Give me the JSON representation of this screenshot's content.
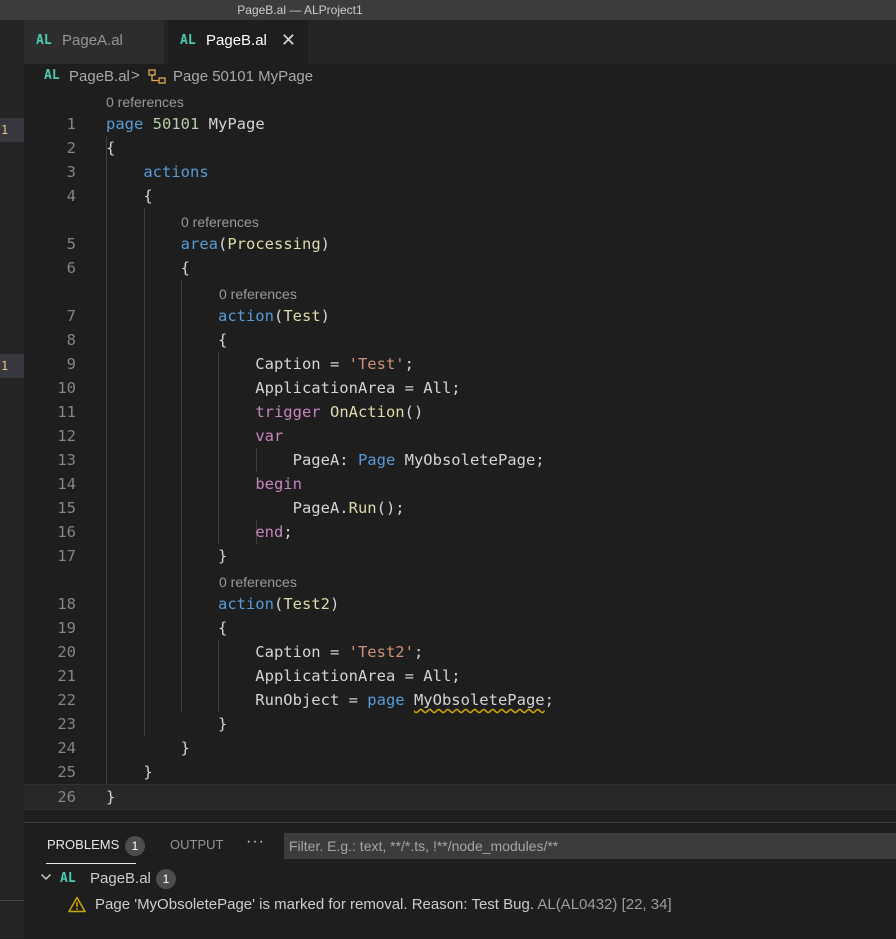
{
  "window": {
    "title": "PageB.al — ALProject1"
  },
  "tabs": [
    {
      "lang": "AL",
      "label": "PageA.al"
    },
    {
      "lang": "AL",
      "label": "PageB.al",
      "close": "✕"
    }
  ],
  "breadcrumb": {
    "lang": "AL",
    "file": "PageB.al",
    "separator": ">",
    "symbol": "Page 50101 MyPage"
  },
  "gutter_marks": [
    "1",
    "1"
  ],
  "codelens": {
    "text": "0 references"
  },
  "code_lines": [
    {
      "n": "1",
      "t": "page 50101 MyPage"
    },
    {
      "n": "2",
      "t": "{"
    },
    {
      "n": "3",
      "t": "    actions"
    },
    {
      "n": "4",
      "t": "    {"
    },
    {
      "n": "5",
      "t": "        area(Processing)"
    },
    {
      "n": "6",
      "t": "        {"
    },
    {
      "n": "7",
      "t": "            action(Test)"
    },
    {
      "n": "8",
      "t": "            {"
    },
    {
      "n": "9",
      "t": "                Caption = 'Test';"
    },
    {
      "n": "10",
      "t": "                ApplicationArea = All;"
    },
    {
      "n": "11",
      "t": "                trigger OnAction()"
    },
    {
      "n": "12",
      "t": "                var"
    },
    {
      "n": "13",
      "t": "                    PageA: Page MyObsoletePage;"
    },
    {
      "n": "14",
      "t": "                begin"
    },
    {
      "n": "15",
      "t": "                    PageA.Run();"
    },
    {
      "n": "16",
      "t": "                end;"
    },
    {
      "n": "17",
      "t": "            }"
    },
    {
      "n": "18",
      "t": "            action(Test2)"
    },
    {
      "n": "19",
      "t": "            {"
    },
    {
      "n": "20",
      "t": "                Caption = 'Test2';"
    },
    {
      "n": "21",
      "t": "                ApplicationArea = All;"
    },
    {
      "n": "22",
      "t": "                RunObject = page MyObsoletePage;"
    },
    {
      "n": "23",
      "t": "            }"
    },
    {
      "n": "24",
      "t": "        }"
    },
    {
      "n": "25",
      "t": "    }"
    },
    {
      "n": "26",
      "t": "}"
    }
  ],
  "panel": {
    "problems_label": "PROBLEMS",
    "problems_count": "1",
    "output_label": "OUTPUT",
    "more_label": "···",
    "filter_placeholder": "Filter. E.g.: text, **/*.ts, !**/node_modules/**",
    "group": {
      "lang": "AL",
      "file": "PageB.al",
      "count": "1"
    },
    "problem": {
      "message": "Page 'MyObsoletePage' is marked for removal. Reason: Test Bug.",
      "source": "AL(AL0432)",
      "location": "[22, 34]"
    }
  },
  "colors": {
    "keyword": "#569cd6",
    "control": "#c586c0",
    "string": "#ce9178",
    "number": "#b5cea8",
    "function": "#dcdcaa",
    "warning": "#cca700",
    "al_badge": "#4ec9b0"
  }
}
